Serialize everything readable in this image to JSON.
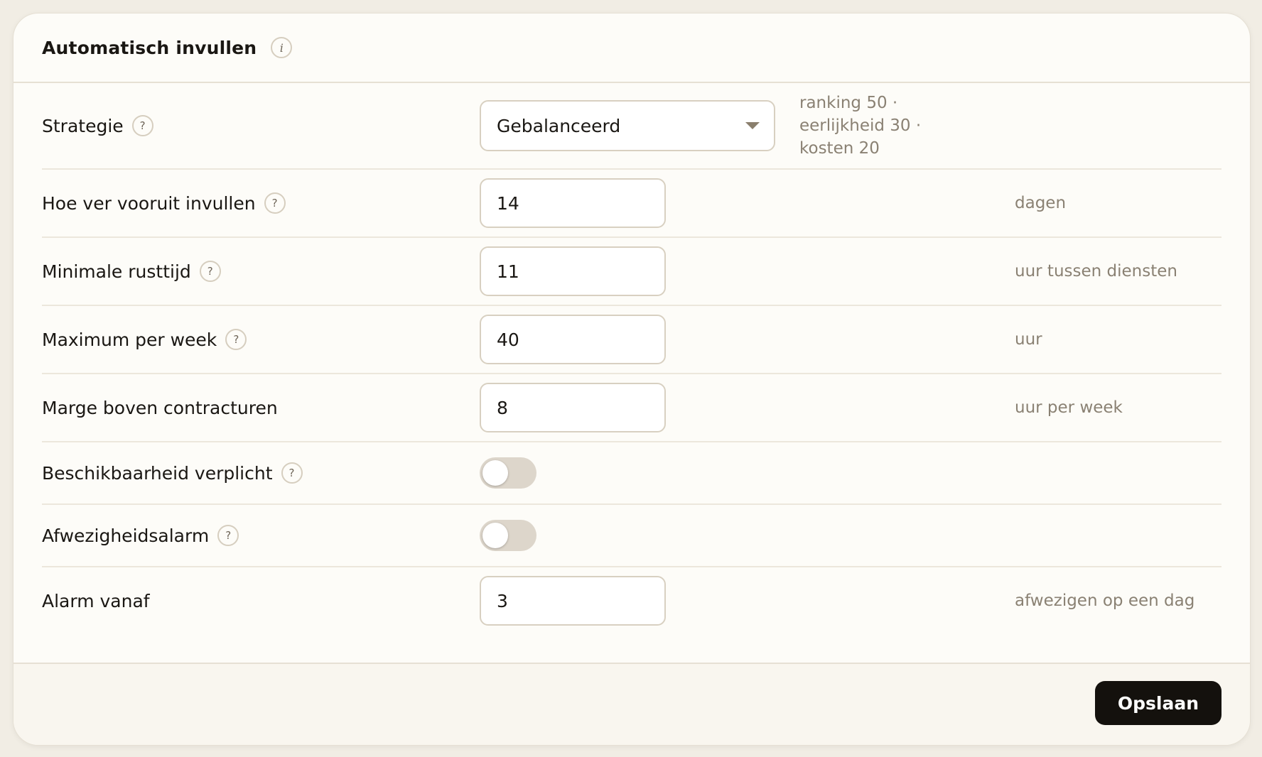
{
  "panel": {
    "title": "Automatisch invullen",
    "info_icon": "i"
  },
  "help_glyph": "?",
  "strategy": {
    "label": "Strategie",
    "value": "Gebalanceerd",
    "note_lines": [
      "ranking 50 ·",
      "eerlijkheid 30 ·",
      "kosten 20"
    ]
  },
  "fields": {
    "horizon": {
      "label": "Hoe ver vooruit invullen",
      "value": "14",
      "unit": "dagen"
    },
    "min_rest": {
      "label": "Minimale rusttijd",
      "value": "11",
      "unit": "uur tussen diensten"
    },
    "max_week": {
      "label": "Maximum per week",
      "value": "40",
      "unit": "uur"
    },
    "margin": {
      "label": "Marge boven contracturen",
      "value": "8",
      "unit": "uur per week"
    },
    "availability_required": {
      "label": "Beschikbaarheid verplicht",
      "enabled": false
    },
    "absence_alarm": {
      "label": "Afwezigheidsalarm",
      "enabled": false
    },
    "alarm_from": {
      "label": "Alarm vanaf",
      "value": "3",
      "unit": "afwezigen op een dag"
    }
  },
  "footer": {
    "save_label": "Opslaan"
  },
  "colors": {
    "background": "#f1ede4",
    "card": "#fdfcf8",
    "button": "#14110d",
    "toggle_off": "#ddd6cb"
  }
}
